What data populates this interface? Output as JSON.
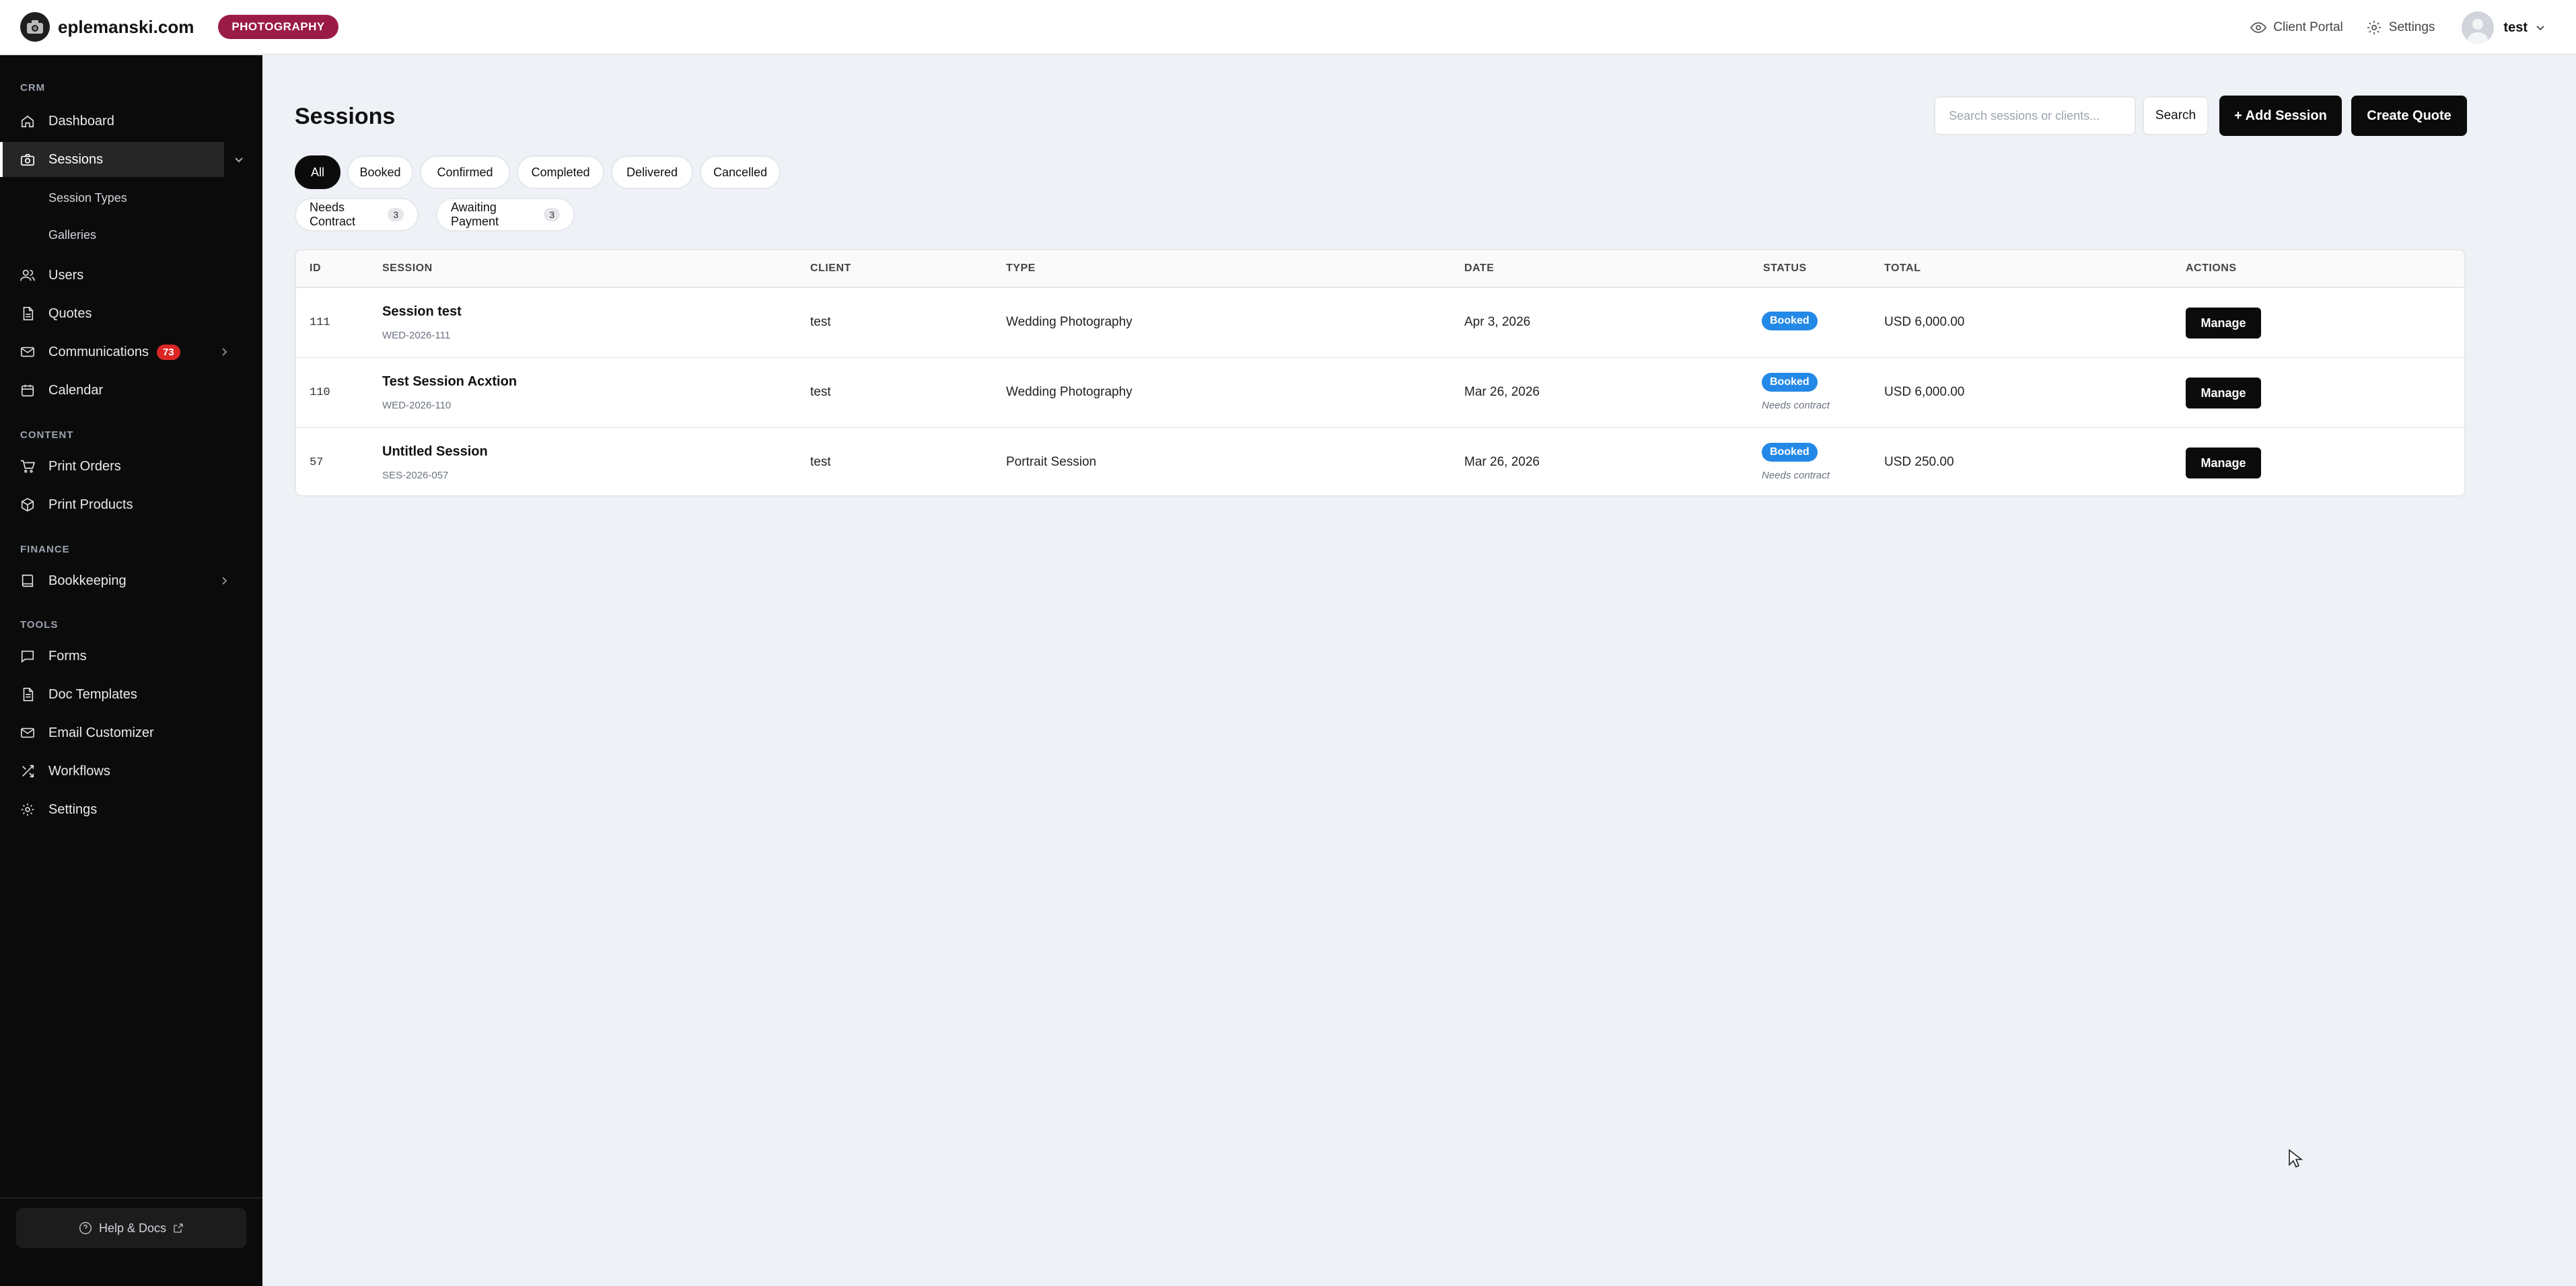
{
  "header": {
    "site_name": "eplemanski.com",
    "badge": "PHOTOGRAPHY",
    "client_portal": "Client Portal",
    "settings": "Settings",
    "user_name": "test"
  },
  "sidebar": {
    "sections": {
      "crm": "CRM",
      "content": "CONTENT",
      "finance": "FINANCE",
      "tools": "TOOLS"
    },
    "items": {
      "dashboard": "Dashboard",
      "sessions": "Sessions",
      "session_types": "Session Types",
      "galleries": "Galleries",
      "users": "Users",
      "quotes": "Quotes",
      "communications": "Communications",
      "communications_count": "73",
      "calendar": "Calendar",
      "print_orders": "Print Orders",
      "print_products": "Print Products",
      "bookkeeping": "Bookkeeping",
      "forms": "Forms",
      "doc_templates": "Doc Templates",
      "email_customizer": "Email Customizer",
      "workflows": "Workflows",
      "settings": "Settings"
    },
    "help": "Help & Docs"
  },
  "main": {
    "title": "Sessions",
    "search_placeholder": "Search sessions or clients...",
    "search_button": "Search",
    "add_session": "+ Add Session",
    "create_quote": "Create Quote",
    "filters": {
      "all": "All",
      "booked": "Booked",
      "confirmed": "Confirmed",
      "completed": "Completed",
      "delivered": "Delivered",
      "cancelled": "Cancelled",
      "needs_contract": "Needs Contract",
      "needs_contract_count": "3",
      "awaiting_payment": "Awaiting Payment",
      "awaiting_payment_count": "3"
    },
    "table": {
      "headers": {
        "id": "ID",
        "session": "SESSION",
        "client": "CLIENT",
        "type": "TYPE",
        "date": "DATE",
        "status": "STATUS",
        "total": "TOTAL",
        "actions": "ACTIONS"
      },
      "rows": [
        {
          "id": "111",
          "name": "Session test",
          "code": "WED-2026-111",
          "client": "test",
          "type": "Wedding Photography",
          "date": "Apr 3, 2026",
          "status": "Booked",
          "note": "",
          "total": "USD 6,000.00",
          "action": "Manage"
        },
        {
          "id": "110",
          "name": "Test Session Acxtion",
          "code": "WED-2026-110",
          "client": "test",
          "type": "Wedding Photography",
          "date": "Mar 26, 2026",
          "status": "Booked",
          "note": "Needs contract",
          "total": "USD 6,000.00",
          "action": "Manage"
        },
        {
          "id": "57",
          "name": "Untitled Session",
          "code": "SES-2026-057",
          "client": "test",
          "type": "Portrait Session",
          "date": "Mar 26, 2026",
          "status": "Booked",
          "note": "Needs contract",
          "total": "USD 250.00",
          "action": "Manage"
        }
      ]
    }
  },
  "colors": {
    "brand_badge": "#9b1b47",
    "status_booked": "#2489e6",
    "alert_badge": "#dc2626",
    "sidebar_bg": "#0b0b0b"
  }
}
